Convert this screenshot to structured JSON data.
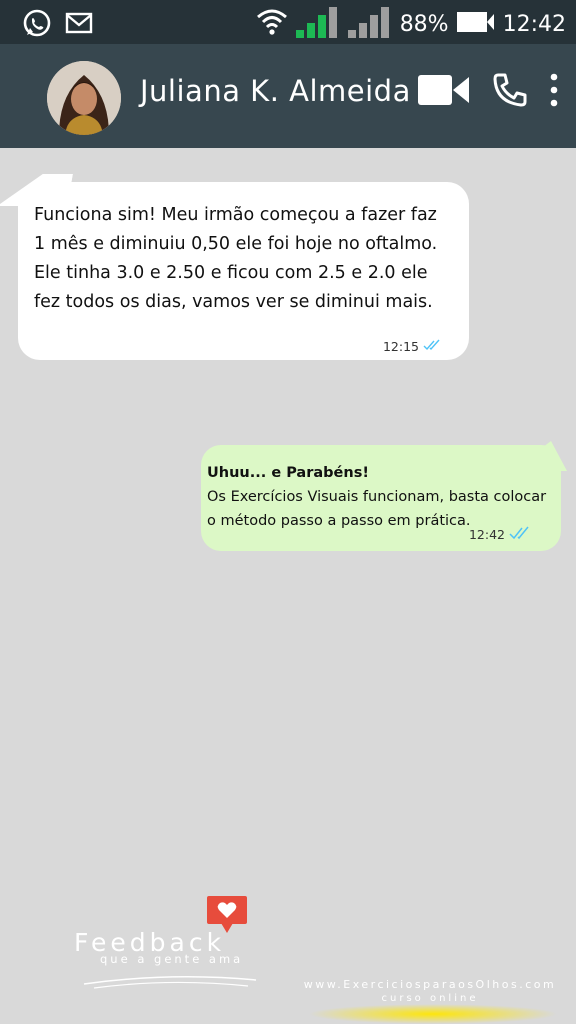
{
  "status_bar": {
    "battery_percent": "88%",
    "time": "12:42",
    "icons": [
      "whatsapp-icon",
      "mail-icon",
      "wifi-icon",
      "signal-bars-icon",
      "signal-bars-icon",
      "battery-icon"
    ]
  },
  "header": {
    "contact_name": "Juliana K. Almeida",
    "icons": [
      "video-call-icon",
      "phone-call-icon",
      "more-options-icon"
    ]
  },
  "messages": [
    {
      "direction": "incoming",
      "text": "Funciona sim! Meu irmão começou a fazer faz 1 mês e diminuiu 0,50 ele foi hoje no oftalmo. Ele tinha 3.0 e 2.50 e ficou com 2.5 e 2.0 ele fez todos os dias, vamos ver se diminui mais.",
      "time": "12:15"
    },
    {
      "direction": "outgoing",
      "title": "Uhuu... e Parabéns!",
      "text": "Os Exercícios Visuais funcionam, basta colocar o método passo a passo em prática.",
      "time": "12:42"
    }
  ],
  "branding": {
    "feedback_word": "Feedback",
    "feedback_sub": "que a gente ama",
    "site_url": "www.ExerciciosparaosOlhos.com",
    "site_sub": "curso online"
  },
  "colors": {
    "status_bar": "#263238",
    "app_bar": "#37474f",
    "chat_background": "#d9d9d9",
    "incoming_bubble": "#ffffff",
    "outgoing_bubble": "#dcf8c6",
    "read_ticks": "#4fc3f7",
    "heart_badge": "#e74c3c"
  }
}
